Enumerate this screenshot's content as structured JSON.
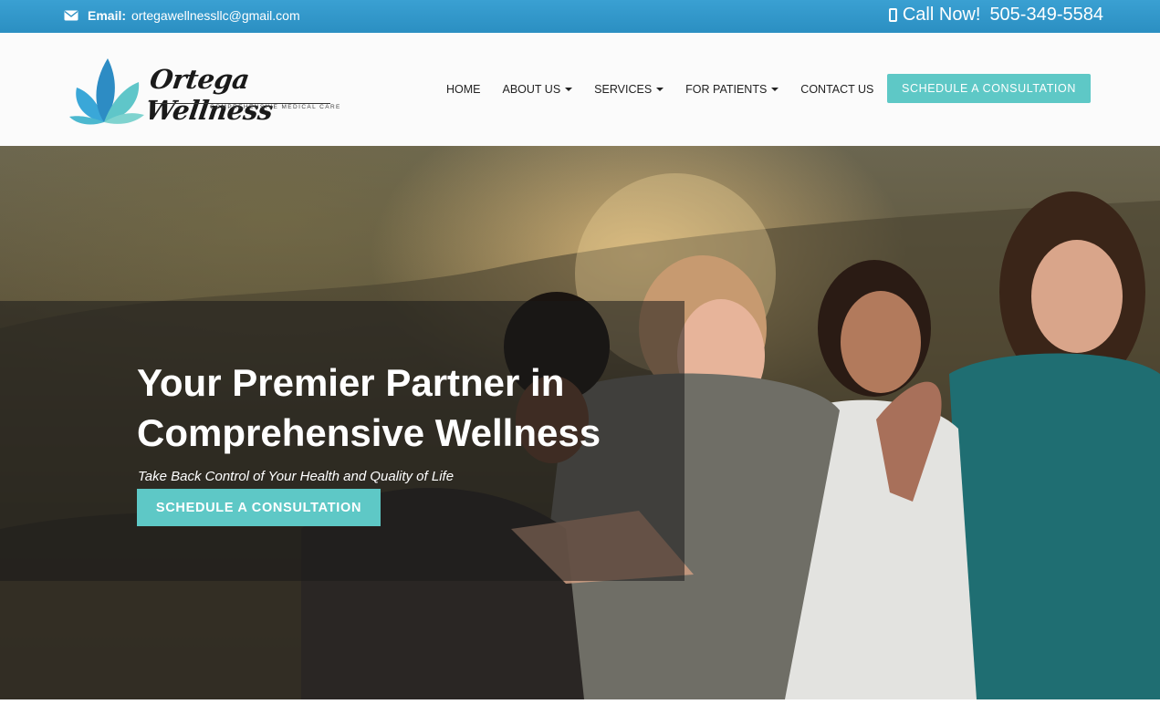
{
  "topbar": {
    "email_label": "Email:",
    "email": "ortegawellnessllc@gmail.com",
    "call_label": "Call Now!",
    "phone": "505-349-5584",
    "icons": [
      "envelope-icon",
      "mobile-phone-icon"
    ]
  },
  "brand": {
    "name": "Ortega Wellness",
    "tagline": "COMPREHENSIVE MEDICAL CARE",
    "colors": {
      "teal": "#5ec8c6",
      "blue": "#2b8fc2"
    }
  },
  "nav": {
    "items": [
      {
        "label": "HOME",
        "dropdown": false
      },
      {
        "label": "ABOUT US",
        "dropdown": true
      },
      {
        "label": "SERVICES",
        "dropdown": true
      },
      {
        "label": "FOR PATIENTS",
        "dropdown": true
      },
      {
        "label": "CONTACT US",
        "dropdown": false
      }
    ],
    "cta": "SCHEDULE A CONSULTATION"
  },
  "hero": {
    "title_line1": "Your Premier Partner in",
    "title_line2": "Comprehensive Wellness",
    "subtitle": "Take Back Control of Your Health and Quality of Life",
    "cta": "SCHEDULE A CONSULTATION"
  }
}
